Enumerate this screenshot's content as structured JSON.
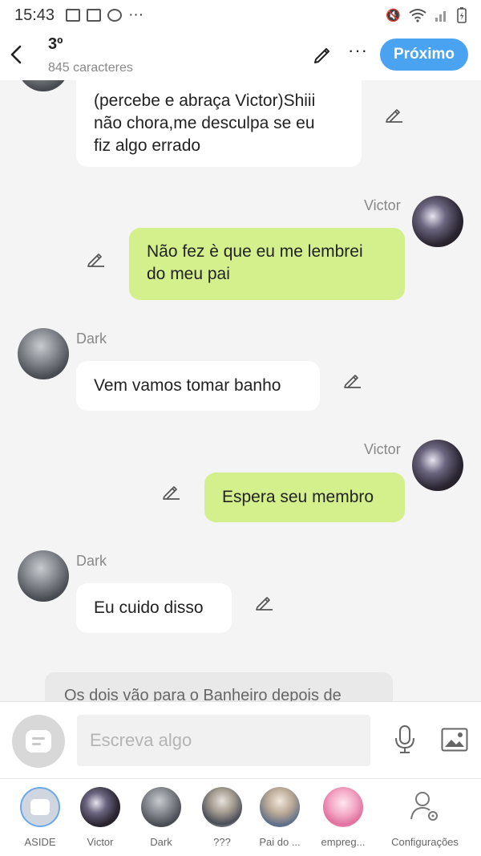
{
  "status_bar": {
    "time": "15:43",
    "more": "···"
  },
  "header": {
    "back_icon": "chevron-left-icon",
    "title": "3º",
    "subtitle": "845 caracteres",
    "more": "···",
    "next_label": "Próximo",
    "accent_color": "#4aa3f0"
  },
  "messages": [
    {
      "side": "left",
      "speaker": "",
      "text_lines": [
        "(percebe e abraça Victor)Shiii",
        "não chora,me desculpa se eu",
        "fiz algo errado"
      ]
    },
    {
      "side": "right",
      "speaker": "Victor",
      "text_lines": [
        "Não fez è que eu me lembrei",
        "do meu pai"
      ]
    },
    {
      "side": "left",
      "speaker": "Dark",
      "text_lines": [
        "Vem vamos tomar banho"
      ]
    },
    {
      "side": "right",
      "speaker": "Victor",
      "text_lines": [
        "Espera seu membro"
      ]
    },
    {
      "side": "left",
      "speaker": "Dark",
      "text_lines": [
        "Eu cuido disso"
      ]
    }
  ],
  "narration": "Os dois vão para o Banheiro depois de",
  "input": {
    "placeholder": "Escreva algo",
    "value": ""
  },
  "tabs": [
    {
      "label": "ASIDE"
    },
    {
      "label": "Victor"
    },
    {
      "label": "Dark"
    },
    {
      "label": "???"
    },
    {
      "label": "Pai do ..."
    },
    {
      "label": "empreg..."
    },
    {
      "label": "Configurações"
    }
  ],
  "colors": {
    "right_bubble": "#d4f08d",
    "left_bubble": "#ffffff",
    "background": "#f4f4f4"
  }
}
